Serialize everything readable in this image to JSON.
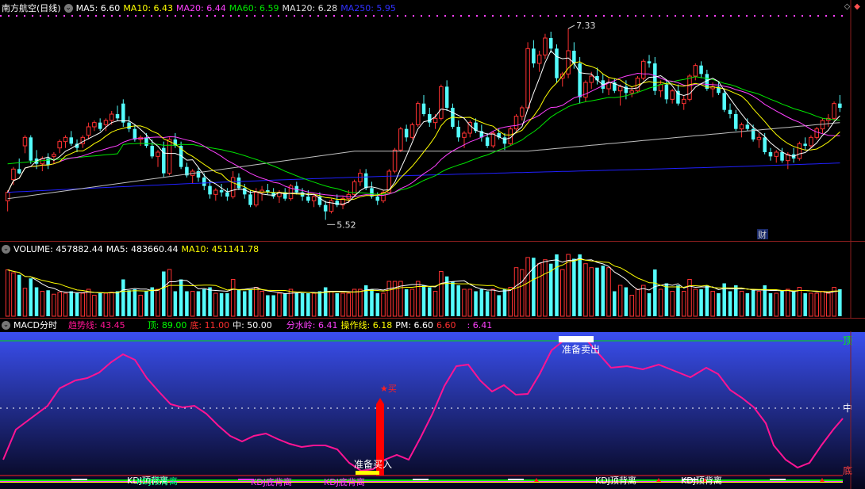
{
  "price_header": {
    "title": "南方航空(日线)",
    "ma5": "MA5: 6.60",
    "ma10": "MA10: 6.43",
    "ma20": "MA20: 6.44",
    "ma60": "MA60: 6.59",
    "ma120": "MA120: 6.28",
    "ma250": "MA250: 5.95"
  },
  "price_annotations": {
    "high": "7.33",
    "low": "5.52",
    "cai": "财"
  },
  "volume_header": {
    "volume": "VOLUME: 457882.44",
    "ma5": "MA5: 483660.44",
    "ma10": "MA10: 451141.78"
  },
  "indicator_header": {
    "name": "MACD分时",
    "trend": "趋势线: 43.45",
    "top": "顶: 89.00",
    "bottom": "底: 11.00",
    "mid": "中: 50.00",
    "divide": "分水岭: 6.41",
    "operate": "操作线: 6.18",
    "pm": "PM: 6.60",
    "v1": "6.60",
    "v2": ": 6.41"
  },
  "indicator_labels": {
    "ding": "顶",
    "zhong": "中",
    "di": "底",
    "sell": "准备卖出",
    "buy": "准备买入",
    "star": "★买",
    "kdj1": "KDJ顶背离",
    "kdj2": "KDJ顶背离",
    "kdj3": "KDJ顶背离",
    "kdj4": "KDJ底背离",
    "kdj5": "KDJ底背离"
  },
  "colors": {
    "up": "#ff3232",
    "down": "#54fcfc",
    "ma5": "#ffffff",
    "ma10": "#ffff00",
    "ma20": "#ff40ff",
    "ma60": "#00e600",
    "ma120": "#c0c0c0",
    "ma250": "#2020ff",
    "trend": "#ff1493"
  },
  "chart_data": {
    "type": "candlestick",
    "price_range": [
      5.35,
      7.45
    ],
    "candles": [
      [
        5.7,
        5.8,
        5.6,
        5.78
      ],
      [
        5.9,
        6.02,
        5.85,
        6.0
      ],
      [
        6.0,
        6.1,
        5.95,
        5.96
      ],
      [
        6.22,
        6.32,
        6.15,
        6.3
      ],
      [
        6.3,
        6.32,
        6.05,
        6.08
      ],
      [
        6.1,
        6.18,
        6.0,
        6.05
      ],
      [
        6.05,
        6.12,
        5.98,
        6.1
      ],
      [
        6.1,
        6.15,
        6.0,
        6.04
      ],
      [
        6.12,
        6.16,
        6.05,
        6.14
      ],
      [
        6.2,
        6.28,
        6.15,
        6.26
      ],
      [
        6.26,
        6.32,
        6.2,
        6.3
      ],
      [
        6.3,
        6.36,
        6.22,
        6.24
      ],
      [
        6.24,
        6.28,
        6.16,
        6.2
      ],
      [
        6.24,
        6.32,
        6.2,
        6.3
      ],
      [
        6.32,
        6.44,
        6.28,
        6.4
      ],
      [
        6.4,
        6.46,
        6.36,
        6.44
      ],
      [
        6.44,
        6.48,
        6.36,
        6.38
      ],
      [
        6.42,
        6.48,
        6.36,
        6.46
      ],
      [
        6.46,
        6.55,
        6.42,
        6.52
      ],
      [
        6.52,
        6.6,
        6.46,
        6.48
      ],
      [
        6.62,
        6.66,
        6.4,
        6.44
      ],
      [
        6.44,
        6.5,
        6.35,
        6.38
      ],
      [
        6.38,
        6.42,
        6.26,
        6.28
      ],
      [
        6.28,
        6.32,
        6.22,
        6.3
      ],
      [
        6.3,
        6.34,
        6.2,
        6.22
      ],
      [
        6.22,
        6.28,
        6.1,
        6.12
      ],
      [
        6.12,
        6.18,
        6.02,
        6.16
      ],
      [
        6.2,
        6.26,
        5.92,
        5.96
      ],
      [
        5.96,
        6.3,
        5.94,
        6.28
      ],
      [
        6.28,
        6.34,
        6.2,
        6.22
      ],
      [
        6.22,
        6.26,
        6.0,
        6.02
      ],
      [
        6.02,
        6.06,
        5.92,
        5.94
      ],
      [
        5.94,
        6.0,
        5.86,
        5.98
      ],
      [
        5.98,
        6.02,
        5.88,
        5.92
      ],
      [
        5.92,
        5.96,
        5.8,
        5.84
      ],
      [
        5.84,
        5.9,
        5.72,
        5.76
      ],
      [
        5.76,
        5.82,
        5.7,
        5.8
      ],
      [
        5.8,
        5.86,
        5.74,
        5.78
      ],
      [
        5.78,
        5.82,
        5.7,
        5.74
      ],
      [
        5.74,
        5.98,
        5.72,
        5.92
      ],
      [
        5.92,
        5.96,
        5.8,
        5.82
      ],
      [
        5.82,
        5.86,
        5.72,
        5.76
      ],
      [
        5.76,
        5.8,
        5.64,
        5.66
      ],
      [
        5.66,
        5.82,
        5.64,
        5.78
      ],
      [
        5.78,
        5.84,
        5.7,
        5.8
      ],
      [
        5.8,
        5.86,
        5.76,
        5.78
      ],
      [
        5.78,
        5.82,
        5.72,
        5.74
      ],
      [
        5.74,
        5.8,
        5.68,
        5.78
      ],
      [
        5.78,
        5.82,
        5.7,
        5.72
      ],
      [
        5.72,
        5.86,
        5.7,
        5.84
      ],
      [
        5.84,
        5.88,
        5.76,
        5.78
      ],
      [
        5.78,
        5.82,
        5.7,
        5.74
      ],
      [
        5.74,
        5.8,
        5.68,
        5.7
      ],
      [
        5.7,
        5.76,
        5.64,
        5.74
      ],
      [
        5.74,
        5.78,
        5.64,
        5.66
      ],
      [
        5.66,
        5.7,
        5.52,
        5.6
      ],
      [
        5.6,
        5.72,
        5.58,
        5.7
      ],
      [
        5.7,
        5.76,
        5.64,
        5.66
      ],
      [
        5.66,
        5.74,
        5.62,
        5.72
      ],
      [
        5.72,
        5.8,
        5.68,
        5.76
      ],
      [
        5.76,
        5.9,
        5.74,
        5.88
      ],
      [
        5.88,
        6.0,
        5.84,
        5.96
      ],
      [
        5.96,
        6.0,
        5.8,
        5.82
      ],
      [
        5.82,
        5.88,
        5.72,
        5.74
      ],
      [
        5.74,
        5.78,
        5.66,
        5.7
      ],
      [
        5.7,
        5.8,
        5.68,
        5.78
      ],
      [
        5.78,
        6.0,
        5.76,
        5.98
      ],
      [
        5.98,
        6.2,
        5.96,
        6.18
      ],
      [
        6.18,
        6.4,
        6.16,
        6.38
      ],
      [
        6.38,
        6.42,
        6.26,
        6.3
      ],
      [
        6.3,
        6.44,
        6.28,
        6.42
      ],
      [
        6.42,
        6.64,
        6.4,
        6.62
      ],
      [
        6.62,
        6.7,
        6.5,
        6.52
      ],
      [
        6.52,
        6.58,
        6.4,
        6.44
      ],
      [
        6.44,
        6.52,
        6.38,
        6.48
      ],
      [
        6.48,
        6.8,
        6.46,
        6.78
      ],
      [
        6.78,
        6.84,
        6.55,
        6.58
      ],
      [
        6.58,
        6.62,
        6.38,
        6.4
      ],
      [
        6.4,
        6.46,
        6.26,
        6.3
      ],
      [
        6.3,
        6.36,
        6.2,
        6.34
      ],
      [
        6.34,
        6.46,
        6.3,
        6.44
      ],
      [
        6.44,
        6.48,
        6.34,
        6.36
      ],
      [
        6.36,
        6.42,
        6.26,
        6.3
      ],
      [
        6.3,
        6.34,
        6.2,
        6.22
      ],
      [
        6.22,
        6.36,
        6.2,
        6.34
      ],
      [
        6.34,
        6.38,
        6.28,
        6.3
      ],
      [
        6.3,
        6.34,
        6.18,
        6.24
      ],
      [
        6.24,
        6.4,
        6.22,
        6.38
      ],
      [
        6.38,
        6.52,
        6.36,
        6.5
      ],
      [
        6.5,
        6.6,
        6.46,
        6.58
      ],
      [
        6.58,
        7.2,
        6.56,
        7.14
      ],
      [
        7.14,
        7.22,
        6.96,
        7.0
      ],
      [
        7.0,
        7.12,
        6.92,
        7.08
      ],
      [
        7.08,
        7.28,
        7.04,
        7.24
      ],
      [
        7.24,
        7.3,
        7.1,
        7.14
      ],
      [
        7.14,
        7.18,
        6.82,
        6.86
      ],
      [
        6.86,
        6.92,
        6.78,
        6.9
      ],
      [
        6.9,
        7.33,
        6.86,
        7.12
      ],
      [
        7.12,
        7.2,
        6.95,
        7.0
      ],
      [
        7.0,
        7.06,
        6.62,
        6.68
      ],
      [
        6.68,
        6.84,
        6.64,
        6.82
      ],
      [
        6.82,
        6.92,
        6.76,
        6.88
      ],
      [
        6.88,
        6.96,
        6.8,
        6.84
      ],
      [
        6.84,
        6.9,
        6.72,
        6.76
      ],
      [
        6.76,
        6.86,
        6.7,
        6.82
      ],
      [
        6.82,
        6.86,
        6.72,
        6.74
      ],
      [
        6.74,
        6.8,
        6.6,
        6.78
      ],
      [
        6.78,
        6.84,
        6.66,
        6.72
      ],
      [
        6.72,
        6.78,
        6.68,
        6.74
      ],
      [
        6.74,
        6.88,
        6.72,
        6.86
      ],
      [
        6.86,
        7.04,
        6.84,
        7.02
      ],
      [
        7.02,
        7.08,
        6.96,
        7.0
      ],
      [
        7.0,
        7.06,
        6.7,
        6.74
      ],
      [
        6.74,
        6.84,
        6.68,
        6.8
      ],
      [
        6.8,
        6.84,
        6.62,
        6.66
      ],
      [
        6.66,
        6.76,
        6.62,
        6.74
      ],
      [
        6.74,
        6.8,
        6.6,
        6.62
      ],
      [
        6.62,
        6.7,
        6.56,
        6.66
      ],
      [
        6.66,
        6.9,
        6.64,
        6.88
      ],
      [
        6.88,
        7.0,
        6.84,
        6.98
      ],
      [
        6.98,
        7.02,
        6.86,
        6.9
      ],
      [
        6.9,
        6.94,
        6.74,
        6.76
      ],
      [
        6.76,
        6.82,
        6.68,
        6.78
      ],
      [
        6.78,
        6.82,
        6.7,
        6.72
      ],
      [
        6.72,
        6.76,
        6.54,
        6.56
      ],
      [
        6.56,
        6.62,
        6.48,
        6.52
      ],
      [
        6.52,
        6.56,
        6.36,
        6.38
      ],
      [
        6.38,
        6.44,
        6.3,
        6.42
      ],
      [
        6.42,
        6.48,
        6.36,
        6.38
      ],
      [
        6.38,
        6.42,
        6.26,
        6.28
      ],
      [
        6.28,
        6.34,
        6.2,
        6.3
      ],
      [
        6.3,
        6.34,
        6.14,
        6.16
      ],
      [
        6.16,
        6.2,
        6.08,
        6.12
      ],
      [
        6.12,
        6.18,
        6.06,
        6.16
      ],
      [
        6.16,
        6.2,
        6.06,
        6.08
      ],
      [
        6.08,
        6.16,
        6.0,
        6.14
      ],
      [
        6.14,
        6.2,
        6.06,
        6.1
      ],
      [
        6.1,
        6.26,
        6.08,
        6.24
      ],
      [
        6.24,
        6.3,
        6.18,
        6.22
      ],
      [
        6.22,
        6.32,
        6.2,
        6.3
      ],
      [
        6.3,
        6.4,
        6.28,
        6.38
      ],
      [
        6.38,
        6.48,
        6.34,
        6.46
      ],
      [
        6.46,
        6.52,
        6.4,
        6.48
      ],
      [
        6.48,
        6.64,
        6.46,
        6.62
      ],
      [
        6.62,
        6.7,
        6.54,
        6.58
      ]
    ],
    "volume_range": [
      0,
      1000000
    ],
    "volumes_per_candle": "generated from price action"
  }
}
